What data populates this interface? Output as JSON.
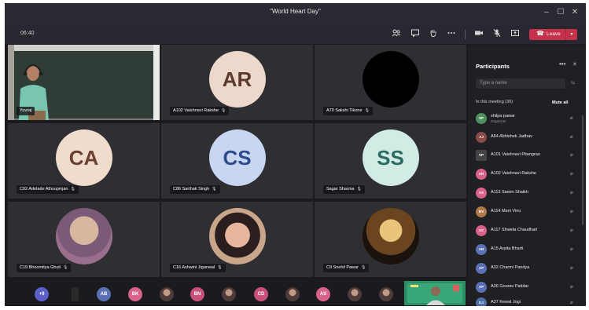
{
  "window": {
    "title": "\"World Heart Day\"",
    "controls": {
      "minimize": "–",
      "maximize": "☐",
      "close": "✕"
    }
  },
  "toolbar": {
    "timer": "06:40",
    "icons": [
      "participants-icon",
      "chat-icon",
      "raise-hand-icon",
      "more-icon",
      "camera-icon",
      "mic-off-icon",
      "share-icon"
    ],
    "leave_label": "Leave",
    "leave_color": "#c4314b"
  },
  "grid": {
    "tiles": [
      {
        "name": "Yuvraj",
        "type": "video"
      },
      {
        "name": "A102 Vaishnavi Rakshe",
        "initials": "AR",
        "avatar_bg": "#ecd9cb",
        "avatar_fg": "#5a3a2e"
      },
      {
        "name": "A70 Sakshi Tikone",
        "initials": "",
        "avatar_bg": "#000000",
        "avatar_fg": "#000000"
      },
      {
        "name": "C02 Adelade Athsupinjan",
        "initials": "CA",
        "avatar_bg": "#f0dccd",
        "avatar_fg": "#6a4030"
      },
      {
        "name": "C86 Sarthak Singh",
        "initials": "CS",
        "avatar_bg": "#c9d6f2",
        "avatar_fg": "#2e4b8c"
      },
      {
        "name": "Sagar Sharma",
        "initials": "SS",
        "avatar_bg": "#d1ebe5",
        "avatar_fg": "#2c6b62"
      },
      {
        "name": "C19 Bhoomitya Ghuli",
        "type": "photo"
      },
      {
        "name": "C16 Ashwini Jiganwal",
        "type": "photo"
      },
      {
        "name": "C9 Snehil Pawar",
        "type": "photo"
      }
    ]
  },
  "strip": {
    "overflow_label": "+9",
    "chips": [
      "",
      "AB",
      "BK",
      "",
      "BN",
      "",
      "CD",
      "",
      "AS",
      "",
      ""
    ],
    "colors": {
      "overflow": "#5b5fc7",
      "AB": "#5b6fb5",
      "BK": "#d9628a",
      "BN": "#c8507a",
      "CD": "#c8507a",
      "AS": "#d9628a"
    }
  },
  "panel": {
    "title": "Participants",
    "search_placeholder": "Type a name",
    "section_label": "In this meeting (30)",
    "mute_all": "Mute all",
    "participants": [
      {
        "name": "shilpa pawar",
        "role": "Organizer",
        "initials": "SP",
        "color": "#4f8f5e"
      },
      {
        "name": "A64 Abhishek Jadhav",
        "initials": "AJ",
        "color": "#8b4a4a"
      },
      {
        "name": "A101 Vaishnavi Pitangrao",
        "initials": "VP",
        "color": "#444444"
      },
      {
        "name": "A102 Vaishnavi Rakshe",
        "initials": "AR",
        "color": "#d9628a"
      },
      {
        "name": "A113 Samin Shaikh",
        "initials": "AS",
        "color": "#d9628a"
      },
      {
        "name": "A114 Mani Vinu",
        "initials": "MV",
        "color": "#b07a4a"
      },
      {
        "name": "A117 Shweta Chaudhari",
        "initials": "AC",
        "color": "#d9628a"
      },
      {
        "name": "A15 Arpita Bharti",
        "initials": "AB",
        "color": "#5b6fb5"
      },
      {
        "name": "A32 Charmi Pandya",
        "initials": "AP",
        "color": "#5b6fb5"
      },
      {
        "name": "A36 Gourav Patidar",
        "initials": "AP",
        "color": "#5b6fb5"
      },
      {
        "name": "A37 Kewal Jogi",
        "initials": "KJ",
        "color": "#4f6fa5"
      }
    ]
  }
}
